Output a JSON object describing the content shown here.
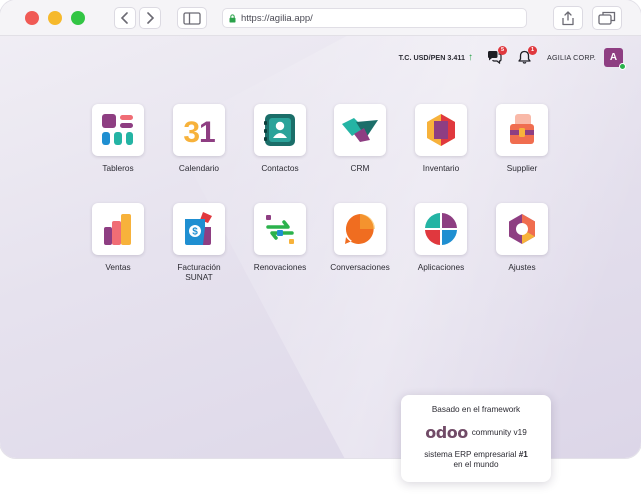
{
  "browser": {
    "url": "https://agilia.app/"
  },
  "topbar": {
    "rate_label": "T.C. USD/PEN 3.411",
    "messages_count": "5",
    "notifications_count": "1",
    "company": "AGILIA CORP.",
    "avatar_initial": "A"
  },
  "apps": [
    {
      "label": "Tableros",
      "icon": "dashboards-icon"
    },
    {
      "label": "Calendario",
      "icon": "calendar-icon",
      "glyph": "31"
    },
    {
      "label": "Contactos",
      "icon": "contacts-icon"
    },
    {
      "label": "CRM",
      "icon": "crm-icon"
    },
    {
      "label": "Inventario",
      "icon": "inventory-icon"
    },
    {
      "label": "Supplier",
      "icon": "supplier-icon"
    },
    {
      "label": "Ventas",
      "icon": "sales-icon"
    },
    {
      "label": "Facturación SUNAT",
      "line1": "Facturación",
      "line2": "SUNAT",
      "icon": "invoicing-icon"
    },
    {
      "label": "Renovaciones",
      "icon": "renewals-icon"
    },
    {
      "label": "Conversaciones",
      "icon": "conversations-icon"
    },
    {
      "label": "Aplicaciones",
      "icon": "apps-icon"
    },
    {
      "label": "Ajustes",
      "icon": "settings-icon"
    }
  ],
  "badge": {
    "line1": "Basado en el framework",
    "logo": "odoo",
    "version": "community v19",
    "line3_prefix": "sistema ERP empresarial ",
    "line3_bold": "#1",
    "line4": "en el mundo"
  },
  "colors": {
    "avatar": "#8e3e82",
    "badge_red": "#e0383e",
    "online_green": "#2bb24c",
    "odoo_purple": "#714b67"
  }
}
